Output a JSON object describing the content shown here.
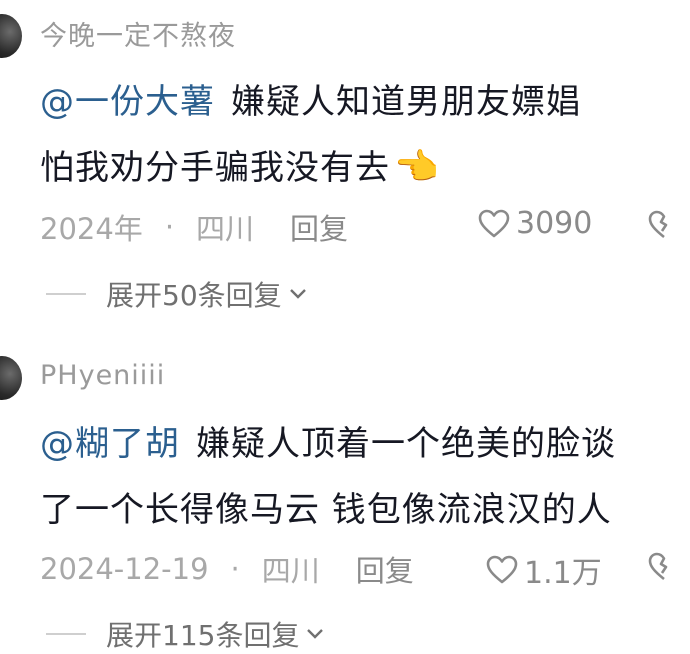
{
  "comments": [
    {
      "username": "今晚一定不熬夜",
      "mention": "@一份大薯",
      "line1_text": "嫌疑人知道男朋友嫖娼",
      "line2_text": "怕我劝分手骗我没有去",
      "emoji": "👈",
      "date": "2024年",
      "separator": "·",
      "location": "四川",
      "reply_label": "回复",
      "likes": "3090",
      "expand_label": "展开50条回复"
    },
    {
      "username": "PHyeniiii",
      "mention": "@糊了胡",
      "line1_text": "嫌疑人顶着一个绝美的脸谈",
      "line2_text": "了一个长得像马云 钱包像流浪汉的人",
      "date": "2024-12-19",
      "separator": "·",
      "location": "四川",
      "reply_label": "回复",
      "likes": "1.1万",
      "expand_label": "展开115条回复"
    }
  ],
  "colors": {
    "mention": "#2b5f8f",
    "text": "#161823",
    "meta": "#a8a8a8"
  },
  "icons": [
    "avatar",
    "heart-icon",
    "broken-heart-icon",
    "chevron-down-icon",
    "pointing-hand-emoji"
  ]
}
